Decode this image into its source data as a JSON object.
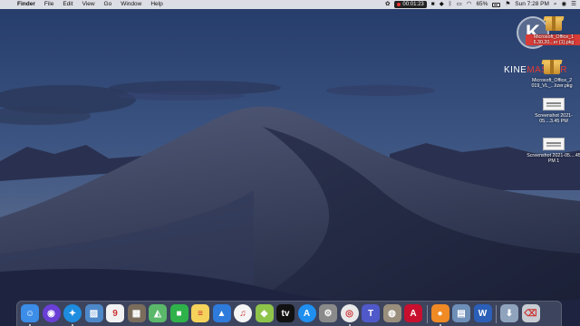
{
  "menubar": {
    "apple_icon": "apple-logo-icon",
    "app_name": "Finder",
    "menus": [
      "File",
      "Edit",
      "View",
      "Go",
      "Window",
      "Help"
    ],
    "recording_timer": "00:01:23",
    "battery_percent": "65%",
    "datetime": "Sun 7:28 PM"
  },
  "watermark": {
    "logo_letter": "K",
    "name_part1": "KINE",
    "name_part2": "MASTER"
  },
  "desktop_icons": [
    {
      "label": "Microsoft_Office_1 6.30.20...er (1).pkg",
      "type": "package",
      "selected": true
    },
    {
      "label": "Microsoft_Office_2 019_VL_...lizer.pkg",
      "type": "package",
      "selected": false
    },
    {
      "label": "Screenshot 2021-05....3.45 PM",
      "type": "screenshot",
      "selected": false
    },
    {
      "label": "Screenshot 2021-05....45 PM 1",
      "type": "screenshot",
      "selected": false
    }
  ],
  "dock": {
    "apps": [
      {
        "name": "finder-icon",
        "glyph": "☺",
        "color": "#3b8de8"
      },
      {
        "name": "siri-icon",
        "glyph": "◉",
        "color": "#6a3fd6"
      },
      {
        "name": "safari-icon",
        "glyph": "✦",
        "color": "#1e8de0"
      },
      {
        "name": "preview-icon",
        "glyph": "▨",
        "color": "#4d88c9"
      },
      {
        "name": "calendar-icon",
        "glyph": "9",
        "color": "#f2f2f2"
      },
      {
        "name": "photo-library-icon",
        "glyph": "▦",
        "color": "#7a6d5c"
      },
      {
        "name": "maps-icon",
        "glyph": "◭",
        "color": "#5bb86b"
      },
      {
        "name": "facetime-icon",
        "glyph": "■",
        "color": "#2fb24a"
      },
      {
        "name": "notes-icon",
        "glyph": "≡",
        "color": "#f4d25b"
      },
      {
        "name": "keynote-icon",
        "glyph": "▲",
        "color": "#2e7bdc"
      },
      {
        "name": "music-icon",
        "glyph": "♫",
        "color": "#f5f5f5"
      },
      {
        "name": "bluestacks-icon",
        "glyph": "◆",
        "color": "#8fc44a"
      },
      {
        "name": "apple-tv-icon",
        "glyph": "tv",
        "color": "#111111"
      },
      {
        "name": "app-store-icon",
        "glyph": "A",
        "color": "#1f8ff0"
      },
      {
        "name": "system-preferences-icon",
        "glyph": "⚙",
        "color": "#8a8a8a"
      },
      {
        "name": "chrome-icon",
        "glyph": "◎",
        "color": "#e9e9e9"
      },
      {
        "name": "teams-icon",
        "glyph": "T",
        "color": "#5059c9"
      },
      {
        "name": "preview-viewer-icon",
        "glyph": "◍",
        "color": "#9a8f7d"
      },
      {
        "name": "autocad-icon",
        "glyph": "A",
        "color": "#c8102e"
      },
      {
        "name": "screen-recorder-icon",
        "glyph": "●",
        "color": "#f08a24"
      },
      {
        "name": "image-capture-icon",
        "glyph": "▤",
        "color": "#6e8fb8"
      },
      {
        "name": "word-icon",
        "glyph": "W",
        "color": "#2b5fb8"
      },
      {
        "name": "downloads-folder-icon",
        "glyph": "⬇",
        "color": "#8fa3bd"
      },
      {
        "name": "trash-icon",
        "glyph": "⌫",
        "color": "#c8cdd3"
      }
    ]
  }
}
